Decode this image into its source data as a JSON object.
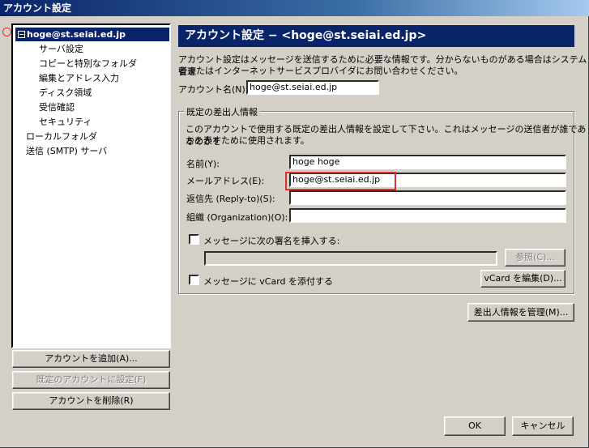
{
  "window": {
    "title": "アカウント設定"
  },
  "tree": {
    "account": "hoge@st.seiai.ed.jp",
    "expander": "−",
    "children": [
      "サーバ設定",
      "コピーと特別なフォルダ",
      "編集とアドレス入力",
      "ディスク領域",
      "受信確認",
      "セキュリティ"
    ],
    "local_folders": "ローカルフォルダ",
    "smtp": "送信 (SMTP) サーバ"
  },
  "left_buttons": {
    "add_account": "アカウントを追加(A)...",
    "set_default": "既定のアカウントに設定(F)",
    "delete_account": "アカウントを削除(R)"
  },
  "panel": {
    "header": "アカウント設定 − <hoge@st.seiai.ed.jp>",
    "description_line1": "アカウント設定はメッセージを送信するために必要な情報です。分からないものがある場合はシステム管理",
    "description_line2": "者またはインターネットサービスプロバイダにお問い合わせください。",
    "account_name_label": "アカウント名(N):",
    "account_name_value": "hoge@st.seiai.ed.jp",
    "identity": {
      "group_title": "既定の差出人情報",
      "desc_line1": "このアカウントで使用する既定の差出人情報を設定して下さい。これはメッセージの送信者が誰であるのかを",
      "desc_line2": "かを表すために使用されます。",
      "name_label": "名前(Y):",
      "name_value": "hoge hoge",
      "email_label": "メールアドレス(E):",
      "email_value": "hoge@st.seiai.ed.jp",
      "reply_label": "返信先 (Reply-to)(S):",
      "reply_value": "",
      "org_label": "組織 (Organization)(O):",
      "org_value": "",
      "sig_checkbox_label": "メッセージに次の署名を挿入する:",
      "sig_value": "",
      "browse_button": "参照(C)...",
      "vcard_checkbox_label": "メッセージに vCard を添付する",
      "vcard_edit_button": "vCard を編集(D)..."
    },
    "manage_identities_button": "差出人情報を管理(M)..."
  },
  "footer": {
    "ok": "OK",
    "cancel": "キャンセル"
  }
}
